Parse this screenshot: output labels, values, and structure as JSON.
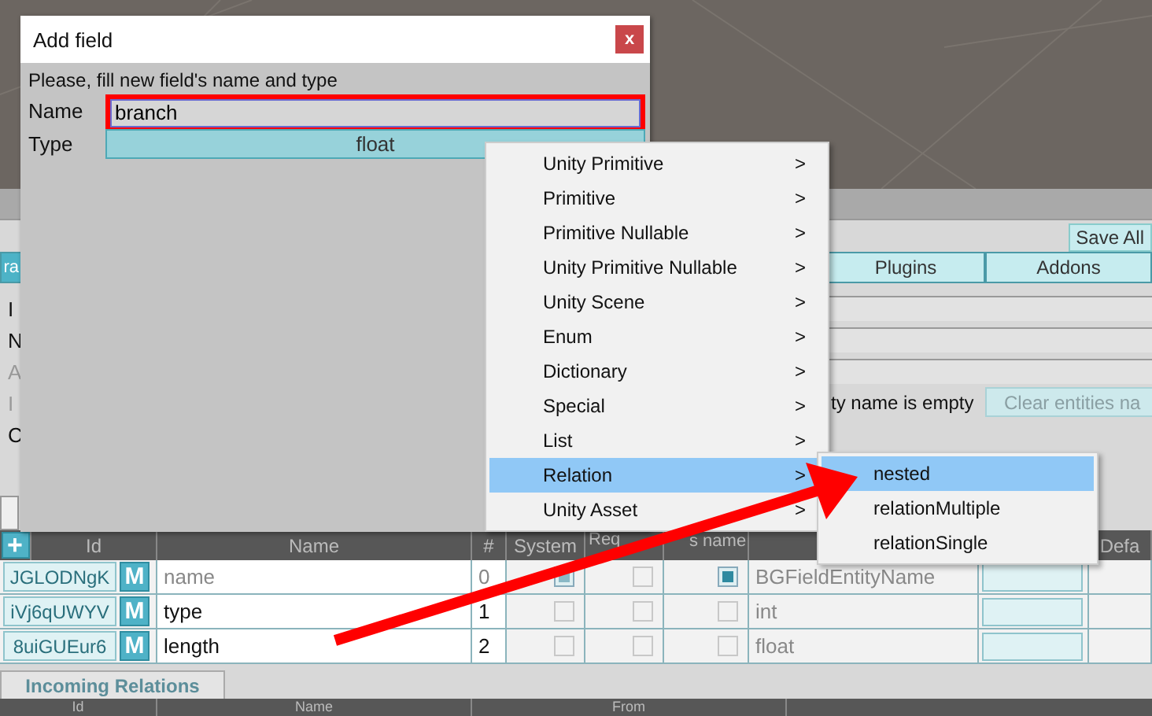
{
  "dialog": {
    "title": "Add field",
    "close": "x",
    "prompt": "Please, fill new field's name and type",
    "name_label": "Name",
    "name_value": "branch",
    "type_label": "Type",
    "type_value": "float"
  },
  "menu": {
    "items": [
      {
        "label": "Unity Primitive",
        "arrow": ">",
        "selected": false
      },
      {
        "label": "Primitive",
        "arrow": ">",
        "selected": false
      },
      {
        "label": "Primitive Nullable",
        "arrow": ">",
        "selected": false
      },
      {
        "label": "Unity Primitive Nullable",
        "arrow": ">",
        "selected": false
      },
      {
        "label": "Unity Scene",
        "arrow": ">",
        "selected": false
      },
      {
        "label": "Enum",
        "arrow": ">",
        "selected": false
      },
      {
        "label": "Dictionary",
        "arrow": ">",
        "selected": false
      },
      {
        "label": "Special",
        "arrow": ">",
        "selected": false
      },
      {
        "label": "List",
        "arrow": ">",
        "selected": false
      },
      {
        "label": "Relation",
        "arrow": ">",
        "selected": true
      },
      {
        "label": "Unity Asset",
        "arrow": ">",
        "selected": false
      }
    ]
  },
  "submenu": {
    "items": [
      {
        "label": "nested",
        "selected": true
      },
      {
        "label": "relationMultiple",
        "selected": false
      },
      {
        "label": "relationSingle",
        "selected": false
      }
    ]
  },
  "editor": {
    "save_button": "Save All",
    "tabs": [
      {
        "label": "ra",
        "selected": true
      },
      {
        "label": "Plugins",
        "selected": false
      },
      {
        "label": "Addons",
        "selected": false
      }
    ],
    "form_labels": [
      {
        "text": "I",
        "disabled": false
      },
      {
        "text": "N",
        "disabled": false
      },
      {
        "text": "A",
        "disabled": true
      },
      {
        "text": "I",
        "disabled": true
      },
      {
        "text": "C",
        "disabled": false
      }
    ],
    "message": "ty name is empty",
    "clear_button": "Clear entities na"
  },
  "fields_table": {
    "add_button": "+",
    "columns": [
      "Id",
      "Name",
      "#",
      "System",
      "Req",
      "s name",
      "Defa"
    ],
    "rows": [
      {
        "id": "JGLODNgK",
        "m": "M",
        "name": "name",
        "index": "0",
        "system": true,
        "required": false,
        "is_name": true,
        "type": "BGFieldEntityName",
        "disabled": true
      },
      {
        "id": "iVj6qUWYV",
        "m": "M",
        "name": "type",
        "index": "1",
        "system": false,
        "required": false,
        "is_name": false,
        "type": "int",
        "disabled": false
      },
      {
        "id": "8uiGUEur6",
        "m": "M",
        "name": "length",
        "index": "2",
        "system": false,
        "required": false,
        "is_name": false,
        "type": "float",
        "disabled": false
      }
    ]
  },
  "incoming": {
    "tab": "Incoming Relations",
    "columns": [
      "Id",
      "Name",
      "From"
    ]
  }
}
